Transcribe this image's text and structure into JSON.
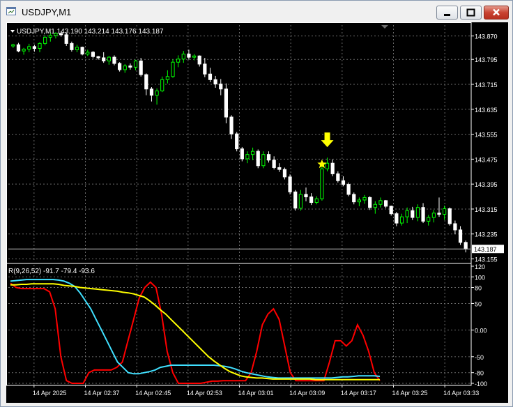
{
  "window": {
    "title": "USDJPY,M1",
    "buttons": [
      "minimize",
      "maximize",
      "close"
    ]
  },
  "colors": {
    "background": "#000000",
    "bull": "#00ff00",
    "bear": "#ffffff",
    "grid": "#6b6b6b",
    "rvi_red": "#ff0000",
    "rvi_cyan": "#40e0ff",
    "rvi_yellow": "#ffff00",
    "marker": "#ffff00"
  },
  "price_panel": {
    "header": "USDJPY,M1  143.190 143.214 143.176 143.187",
    "price_axis": [
      "143.870",
      "143.795",
      "143.715",
      "143.635",
      "143.555",
      "143.475",
      "143.395",
      "143.315",
      "143.235",
      "143.155"
    ],
    "current_price": "143.187",
    "markers": [
      {
        "type": "arrow-down",
        "icon": "down-arrow-icon",
        "candle_index": 59
      },
      {
        "type": "star",
        "icon": "star-icon",
        "candle_index": 58
      }
    ]
  },
  "indicator_panel": {
    "header": "R(9,26,52) -91.7 -79.4 -93.6",
    "axis_labels": [
      "120",
      "100",
      "80",
      "50",
      "0.00",
      "-50",
      "-80",
      "-100"
    ]
  },
  "time_axis": [
    "14 Apr 2025",
    "14 Apr 02:37",
    "14 Apr 02:45",
    "14 Apr 02:53",
    "14 Apr 03:01",
    "14 Apr 03:09",
    "14 Apr 03:17",
    "14 Apr 03:25",
    "14 Apr 03:33"
  ],
  "chart_data": [
    {
      "type": "candlestick",
      "symbol": "USDJPY",
      "timeframe": "M1",
      "ylim": [
        143.145,
        143.905
      ],
      "last": {
        "open": 143.19,
        "high": 143.214,
        "low": 143.176,
        "close": 143.187
      },
      "candles": [
        [
          143.838,
          143.845,
          143.832,
          143.842
        ],
        [
          143.842,
          143.848,
          143.818,
          143.822
        ],
        [
          143.822,
          143.832,
          143.81,
          143.828
        ],
        [
          143.828,
          143.845,
          143.818,
          143.836
        ],
        [
          143.836,
          143.842,
          143.82,
          143.83
        ],
        [
          143.83,
          143.85,
          143.818,
          143.846
        ],
        [
          143.846,
          143.872,
          143.84,
          143.866
        ],
        [
          143.866,
          143.882,
          143.852,
          143.872
        ],
        [
          143.872,
          143.882,
          143.862,
          143.878
        ],
        [
          143.878,
          143.885,
          143.868,
          143.874
        ],
        [
          143.874,
          143.882,
          143.838,
          143.846
        ],
        [
          143.846,
          143.852,
          143.82,
          143.826
        ],
        [
          143.826,
          143.842,
          143.818,
          143.834
        ],
        [
          143.834,
          143.836,
          143.808,
          143.812
        ],
        [
          143.812,
          143.826,
          143.806,
          143.818
        ],
        [
          143.818,
          143.822,
          143.798,
          143.804
        ],
        [
          143.804,
          143.806,
          143.794,
          143.8
        ],
        [
          143.8,
          143.818,
          143.784,
          143.79
        ],
        [
          143.79,
          143.806,
          143.778,
          143.802
        ],
        [
          143.802,
          143.808,
          143.776,
          143.782
        ],
        [
          143.782,
          143.786,
          143.756,
          143.762
        ],
        [
          143.762,
          143.78,
          143.752,
          143.774
        ],
        [
          143.774,
          143.782,
          143.762,
          143.77
        ],
        [
          143.77,
          143.794,
          143.76,
          143.79
        ],
        [
          143.79,
          143.8,
          143.74,
          143.746
        ],
        [
          143.746,
          143.75,
          143.68,
          143.7
        ],
        [
          143.7,
          143.706,
          143.66,
          143.68
        ],
        [
          143.68,
          143.702,
          143.65,
          143.694
        ],
        [
          143.694,
          143.74,
          143.69,
          143.73
        ],
        [
          143.73,
          143.76,
          143.718,
          143.74
        ],
        [
          143.74,
          143.795,
          143.736,
          143.786
        ],
        [
          143.786,
          143.808,
          143.77,
          143.796
        ],
        [
          143.796,
          143.822,
          143.784,
          143.812
        ],
        [
          143.812,
          143.826,
          143.794,
          143.802
        ],
        [
          143.802,
          143.812,
          143.792,
          143.806
        ],
        [
          143.806,
          143.808,
          143.772,
          143.78
        ],
        [
          143.78,
          143.8,
          143.738,
          143.748
        ],
        [
          143.748,
          143.768,
          143.722,
          143.73
        ],
        [
          143.73,
          143.742,
          143.704,
          143.716
        ],
        [
          143.716,
          143.732,
          143.68,
          143.7
        ],
        [
          143.7,
          143.718,
          143.59,
          143.61
        ],
        [
          143.61,
          143.616,
          143.54,
          143.556
        ],
        [
          143.556,
          143.562,
          143.5,
          143.508
        ],
        [
          143.508,
          143.514,
          143.468,
          143.476
        ],
        [
          143.476,
          143.5,
          143.462,
          143.49
        ],
        [
          143.49,
          143.512,
          143.472,
          143.5
        ],
        [
          143.5,
          143.506,
          143.446,
          143.454
        ],
        [
          143.454,
          143.5,
          143.446,
          143.49
        ],
        [
          143.49,
          143.5,
          143.464,
          143.472
        ],
        [
          143.472,
          143.484,
          143.442,
          143.448
        ],
        [
          143.448,
          143.462,
          143.434,
          143.442
        ],
        [
          143.442,
          143.448,
          143.41,
          143.418
        ],
        [
          143.418,
          143.426,
          143.362,
          143.37
        ],
        [
          143.37,
          143.376,
          143.31,
          143.318
        ],
        [
          143.318,
          143.376,
          143.31,
          143.362
        ],
        [
          143.362,
          143.384,
          143.34,
          143.354
        ],
        [
          143.354,
          143.366,
          143.328,
          143.336
        ],
        [
          143.336,
          143.356,
          143.33,
          143.348
        ],
        [
          143.348,
          143.452,
          143.342,
          143.444
        ],
        [
          143.444,
          143.48,
          143.436,
          143.462
        ],
        [
          143.462,
          143.474,
          143.42,
          143.428
        ],
        [
          143.428,
          143.436,
          143.4,
          143.406
        ],
        [
          143.406,
          143.42,
          143.388,
          143.394
        ],
        [
          143.394,
          143.4,
          143.356,
          143.362
        ],
        [
          143.362,
          143.368,
          143.33,
          143.338
        ],
        [
          143.338,
          143.352,
          143.324,
          143.344
        ],
        [
          143.344,
          143.36,
          143.332,
          143.352
        ],
        [
          143.352,
          143.356,
          143.312,
          143.32
        ],
        [
          143.32,
          143.34,
          143.3,
          143.33
        ],
        [
          143.33,
          143.352,
          143.32,
          143.342
        ],
        [
          143.342,
          143.344,
          143.318,
          143.324
        ],
        [
          143.324,
          143.326,
          143.294,
          143.3
        ],
        [
          143.3,
          143.306,
          143.26,
          143.27
        ],
        [
          143.27,
          143.3,
          143.262,
          143.29
        ],
        [
          143.29,
          143.32,
          143.27,
          143.31
        ],
        [
          143.31,
          143.322,
          143.28,
          143.288
        ],
        [
          143.288,
          143.33,
          143.276,
          143.32
        ],
        [
          143.32,
          143.334,
          143.27,
          143.276
        ],
        [
          143.276,
          143.296,
          143.262,
          143.288
        ],
        [
          143.288,
          143.312,
          143.272,
          143.302
        ],
        [
          143.302,
          143.352,
          143.29,
          143.298
        ],
        [
          143.298,
          143.326,
          143.28,
          143.316
        ],
        [
          143.316,
          143.32,
          143.262,
          143.268
        ],
        [
          143.268,
          143.278,
          143.234,
          143.248
        ],
        [
          143.248,
          143.26,
          143.2,
          143.208
        ],
        [
          143.208,
          143.214,
          143.176,
          143.187
        ]
      ]
    },
    {
      "type": "line",
      "title": "R(9,26,52)",
      "ylim": [
        -100,
        120
      ],
      "last_values": [
        -91.7,
        -79.4,
        -93.6
      ],
      "series": [
        {
          "color": "#ff0000",
          "values": [
            88,
            80,
            78,
            78,
            78,
            78,
            78,
            72,
            40,
            -50,
            -95,
            -100,
            -100,
            -100,
            -80,
            -75,
            -75,
            -75,
            -75,
            -70,
            -60,
            -20,
            20,
            60,
            80,
            90,
            80,
            30,
            -40,
            -80,
            -100,
            -100,
            -100,
            -100,
            -100,
            -98,
            -96,
            -96,
            -95,
            -95,
            -95,
            -95,
            -95,
            -80,
            -40,
            10,
            30,
            40,
            20,
            -30,
            -80,
            -95,
            -95,
            -95,
            -95,
            -95,
            -95,
            -60,
            -20,
            -20,
            -30,
            -20,
            10,
            -10,
            -40,
            -80,
            -95
          ]
        },
        {
          "color": "#40e0ff",
          "values": [
            92,
            93,
            94,
            95,
            95,
            95,
            95,
            95,
            95,
            94,
            92,
            88,
            82,
            70,
            55,
            40,
            20,
            0,
            -20,
            -40,
            -60,
            -70,
            -80,
            -82,
            -82,
            -80,
            -78,
            -75,
            -70,
            -68,
            -66,
            -66,
            -66,
            -66,
            -66,
            -66,
            -66,
            -66,
            -66,
            -67,
            -68,
            -70,
            -73,
            -77,
            -80,
            -82,
            -84,
            -86,
            -88,
            -89,
            -90,
            -90,
            -90,
            -90,
            -90,
            -90,
            -90,
            -90,
            -90,
            -90,
            -90,
            -89,
            -88,
            -88,
            -87,
            -86,
            -86,
            -86,
            -86,
            -87
          ]
        },
        {
          "color": "#ffff00",
          "values": [
            85,
            85,
            86,
            86,
            87,
            87,
            87,
            87,
            87,
            86,
            84,
            83,
            82,
            80,
            79,
            78,
            77,
            76,
            75,
            74,
            73,
            71,
            70,
            68,
            65,
            62,
            55,
            47,
            38,
            30,
            20,
            10,
            0,
            -10,
            -20,
            -30,
            -40,
            -50,
            -58,
            -65,
            -72,
            -78,
            -82,
            -86,
            -88,
            -89,
            -90,
            -90,
            -91,
            -92,
            -92,
            -92,
            -92,
            -92,
            -92,
            -92,
            -92,
            -93,
            -93,
            -93,
            -93,
            -93,
            -93,
            -93,
            -93,
            -93,
            -93,
            -93,
            -93,
            -93
          ]
        }
      ]
    }
  ]
}
